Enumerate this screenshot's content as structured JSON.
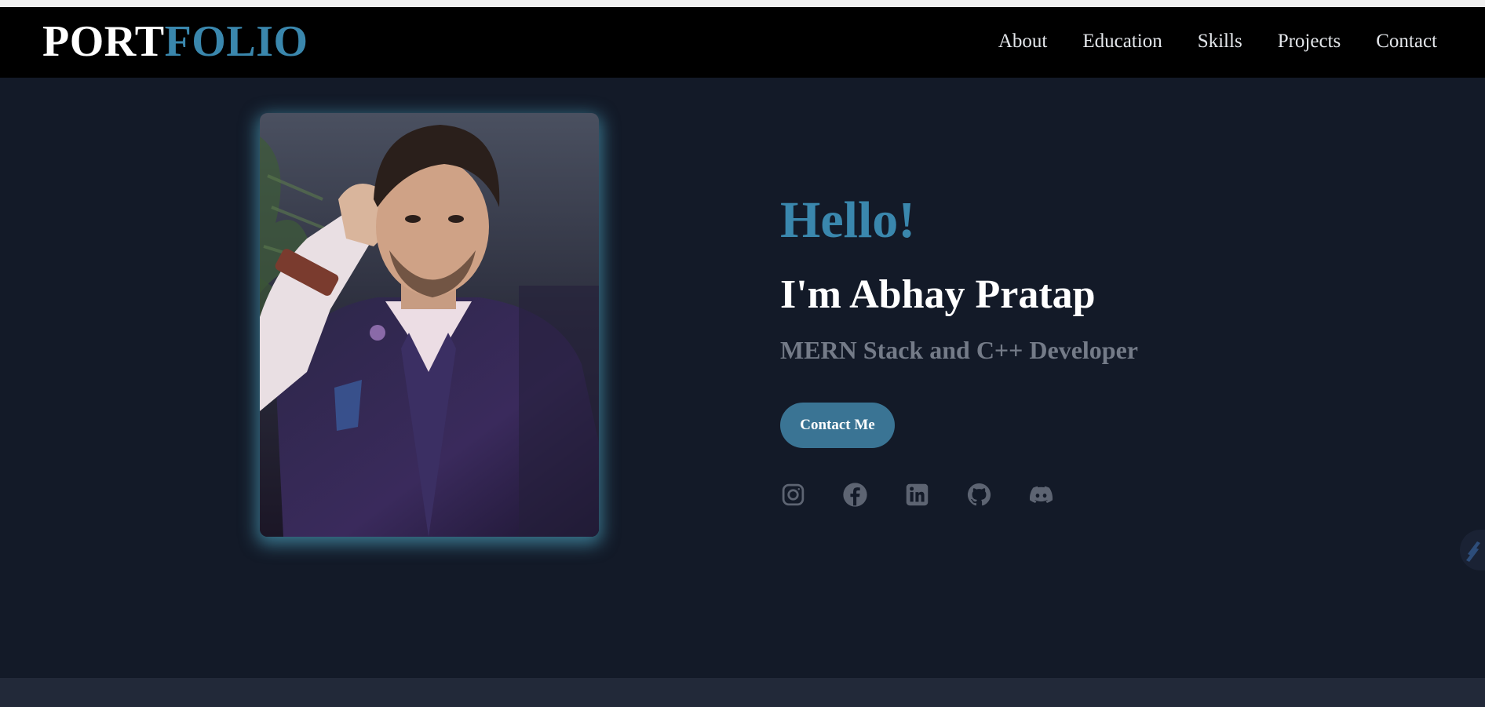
{
  "logo": {
    "part1": "PORT",
    "part2": "FOLIO"
  },
  "nav": {
    "items": [
      {
        "label": "About"
      },
      {
        "label": "Education"
      },
      {
        "label": "Skills"
      },
      {
        "label": "Projects"
      },
      {
        "label": "Contact"
      }
    ]
  },
  "hero": {
    "greeting": "Hello!",
    "name": "I'm Abhay Pratap",
    "role": "MERN Stack and C++ Developer",
    "contact_label": "Contact Me"
  },
  "socials": [
    {
      "icon": "instagram-icon"
    },
    {
      "icon": "facebook-icon"
    },
    {
      "icon": "linkedin-icon"
    },
    {
      "icon": "github-icon"
    },
    {
      "icon": "discord-icon"
    }
  ],
  "colors": {
    "accent": "#3a87ad",
    "background": "#131a28",
    "navbar": "#000000",
    "button": "#3a7494",
    "muted_text": "#747b88"
  }
}
